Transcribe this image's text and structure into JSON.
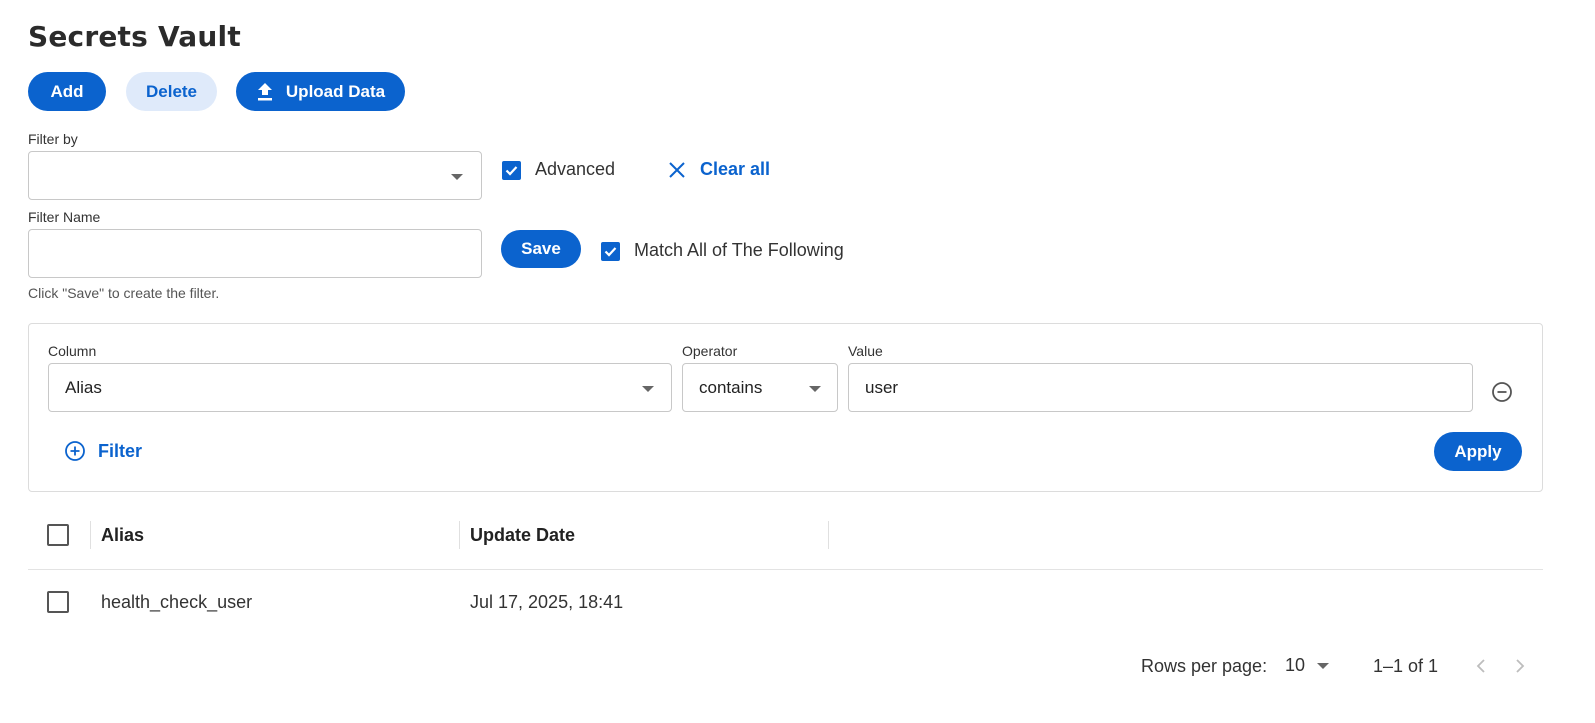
{
  "page": {
    "title": "Secrets Vault"
  },
  "toolbar": {
    "add_label": "Add",
    "delete_label": "Delete",
    "upload_label": "Upload Data"
  },
  "filter": {
    "filter_by_label": "Filter by",
    "filter_by_value": "",
    "advanced_label": "Advanced",
    "advanced_checked": true,
    "clear_all_label": "Clear all",
    "filter_name_label": "Filter Name",
    "filter_name_value": "",
    "save_label": "Save",
    "match_all_label": "Match All of The Following",
    "match_all_checked": true,
    "helper_text": "Click \"Save\" to create the filter."
  },
  "advanced_panel": {
    "column_label": "Column",
    "column_value": "Alias",
    "operator_label": "Operator",
    "operator_value": "contains",
    "value_label": "Value",
    "value_value": "user",
    "add_filter_label": "Filter",
    "apply_label": "Apply"
  },
  "table": {
    "columns": [
      "Alias",
      "Update Date"
    ],
    "rows": [
      {
        "alias": "health_check_user",
        "update_date": "Jul 17, 2025, 18:41"
      }
    ]
  },
  "pagination": {
    "rows_per_page_label": "Rows per page:",
    "rows_per_page_value": "10",
    "range_text": "1–1 of 1"
  },
  "colors": {
    "primary": "#0b63ce",
    "secondary_bg": "#dfeafa"
  }
}
